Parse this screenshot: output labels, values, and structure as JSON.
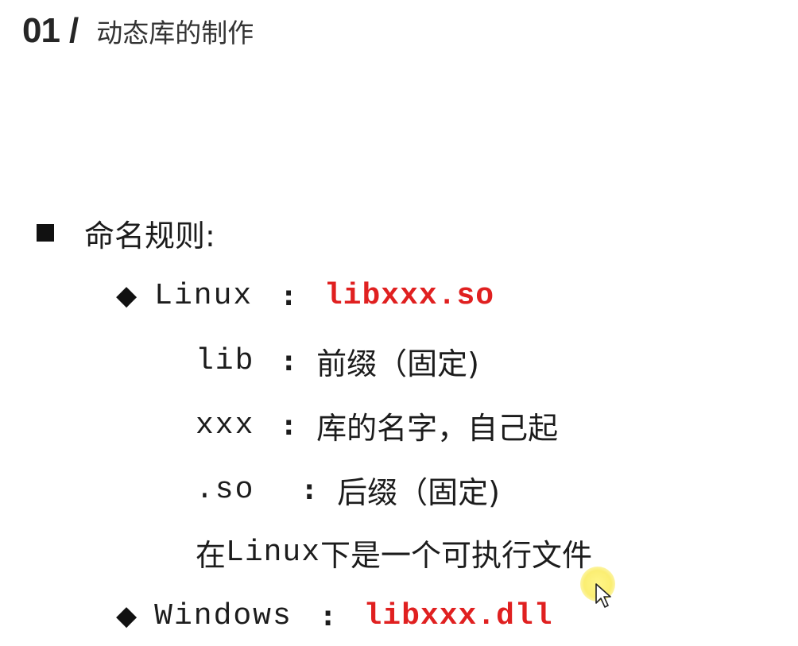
{
  "header": {
    "number": "01",
    "slash": "/",
    "title": "动态库的制作"
  },
  "section": {
    "heading": "命名规则:"
  },
  "linux": {
    "label": "Linux",
    "colon": ":",
    "filename": "libxxx.so",
    "details": [
      {
        "term": "lib",
        "colon": ":",
        "desc": "前缀（固定)"
      },
      {
        "term": "xxx",
        "colon": ":",
        "desc": "库的名字，自己起"
      },
      {
        "term": ".so",
        "colon": ":",
        "desc": "后缀（固定)"
      }
    ],
    "note_pre": "在",
    "note_mono": "Linux",
    "note_post": "下是一个可执行文件"
  },
  "windows": {
    "label": "Windows",
    "colon": ":",
    "filename": "libxxx.dll"
  },
  "colors": {
    "accent": "#e02020",
    "text": "#1c1c1c",
    "cursor_highlight": "#f8e85a"
  },
  "icons": {
    "square_bullet": "square-bullet-icon",
    "diamond_bullet": "diamond-bullet-icon",
    "cursor": "mouse-cursor-icon"
  }
}
